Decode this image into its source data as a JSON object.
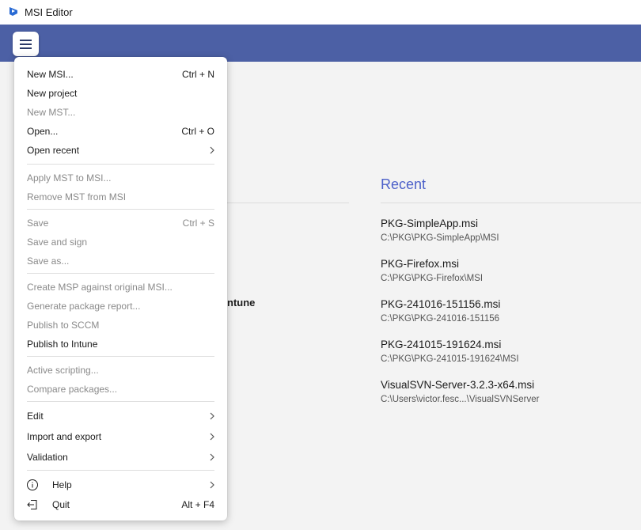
{
  "window": {
    "title": "MSI Editor"
  },
  "header": {
    "menu_icon": "hamburger-menu-icon"
  },
  "background": {
    "partial_text": "ntune"
  },
  "recent": {
    "heading": "Recent",
    "items": [
      {
        "name": "PKG-SimpleApp.msi",
        "path": "C:\\PKG\\PKG-SimpleApp\\MSI"
      },
      {
        "name": "PKG-Firefox.msi",
        "path": "C:\\PKG\\PKG-Firefox\\MSI"
      },
      {
        "name": "PKG-241016-151156.msi",
        "path": "C:\\PKG\\PKG-241016-151156"
      },
      {
        "name": "PKG-241015-191624.msi",
        "path": "C:\\PKG\\PKG-241015-191624\\MSI"
      },
      {
        "name": "VisualSVN-Server-3.2.3-x64.msi",
        "path": "C:\\Users\\victor.fesc...\\VisualSVNServer"
      }
    ]
  },
  "menu": {
    "new_msi": {
      "label": "New MSI...",
      "shortcut": "Ctrl + N"
    },
    "new_project": {
      "label": "New project"
    },
    "new_mst": {
      "label": "New MST..."
    },
    "open": {
      "label": "Open...",
      "shortcut": "Ctrl + O"
    },
    "open_recent": {
      "label": "Open recent"
    },
    "apply_mst": {
      "label": "Apply MST to MSI..."
    },
    "remove_mst": {
      "label": "Remove MST from MSI"
    },
    "save": {
      "label": "Save",
      "shortcut": "Ctrl + S"
    },
    "save_sign": {
      "label": "Save and sign"
    },
    "save_as": {
      "label": "Save as..."
    },
    "create_msp": {
      "label": "Create MSP against original MSI..."
    },
    "generate_report": {
      "label": "Generate package report..."
    },
    "publish_sccm": {
      "label": "Publish to SCCM"
    },
    "publish_intune": {
      "label": "Publish to Intune"
    },
    "active_scripting": {
      "label": "Active scripting..."
    },
    "compare": {
      "label": "Compare packages..."
    },
    "edit": {
      "label": "Edit"
    },
    "import_export": {
      "label": "Import and export"
    },
    "validation": {
      "label": "Validation"
    },
    "help": {
      "label": "Help",
      "icon": "info-icon"
    },
    "quit": {
      "label": "Quit",
      "shortcut": "Alt + F4",
      "icon": "exit-icon"
    }
  },
  "colors": {
    "header": "#4c60a5",
    "accent": "#4c60c9",
    "disabled_text": "#8a8a8a"
  }
}
